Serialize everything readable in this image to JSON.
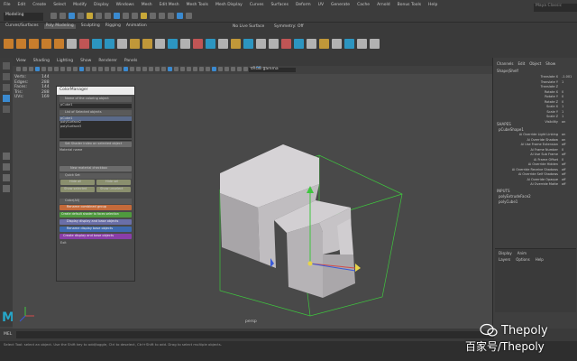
{
  "menubar": {
    "items": [
      "File",
      "Edit",
      "Create",
      "Select",
      "Modify",
      "Display",
      "Windows",
      "Mesh",
      "Edit Mesh",
      "Mesh Tools",
      "Mesh Display",
      "Curves",
      "Surfaces",
      "Deform",
      "UV",
      "Generate",
      "Cache",
      "Arnold",
      "Bonus Tools",
      "Help"
    ],
    "workspace": "Modeling",
    "search_placeholder": "Maya Classic"
  },
  "shelf": {
    "active_tab": "Poly Modeling",
    "tabs": [
      "Curves/Surfaces",
      "Poly Modeling",
      "Sculpting",
      "Rigging",
      "Animation"
    ],
    "no_live_surface": "No Live Surface",
    "symmetry": "Symmetry: Off"
  },
  "viewport_menu": [
    "View",
    "Shading",
    "Lighting",
    "Show",
    "Renderer",
    "Panels"
  ],
  "viewport": {
    "camera_label": "persp",
    "gamma": "sRGB gamma",
    "hud_labels": [
      "Verts:",
      "Edges:",
      "Faces:",
      "Tris:",
      "UVs:"
    ],
    "hud_values": [
      "144",
      "288",
      "144",
      "288",
      "169"
    ],
    "manipulator_colors": {
      "x": "#d24a4a",
      "y": "#3ec63e",
      "z": "#3a5ad8"
    }
  },
  "dialog": {
    "title": "ColorManager",
    "header1": "Name of the coloring object",
    "field_value": "pCube1",
    "header2": "List of Selected objects",
    "list_items": [
      "pCube1",
      "polySurface2",
      "polySurface3"
    ],
    "shader_button": "Set Shader index on selected object",
    "material_label": "Material name",
    "new_material": "New material checkbox",
    "section_label": "Quick Set",
    "buttons": [
      "Hide all",
      "Hide sel",
      "Show selected",
      "Show unselect"
    ],
    "lower_section": "Color(All)",
    "color_buttons": [
      "Rename combined group",
      "Create default shader to faces selection",
      "Display display and base objects",
      "Rename display base objects",
      "Create display and base objects"
    ],
    "footer": "Exit"
  },
  "channel_box": {
    "tabs": [
      "Channels",
      "Edit",
      "Object",
      "Show"
    ],
    "object_name": "Shape|Shelf",
    "attributes": [
      "Translate X",
      "Translate Y",
      "Translate Z",
      "Rotate X",
      "Rotate Y",
      "Rotate Z",
      "Scale X",
      "Scale Y",
      "Scale Z",
      "Visibility"
    ],
    "values": [
      "-1.001",
      "1",
      "",
      "0",
      "0",
      "0",
      "1",
      "1",
      "1",
      "on"
    ],
    "shapes_label": "SHAPES",
    "shape_name": "pCubeShape1",
    "shape_attrs": [
      "Ai Override Light Linking",
      "Ai Override Shadow",
      "Ai Use Frame Extension",
      "Ai Frame Number",
      "Ai Use Sub Frame",
      "Ai Frame Offset",
      "Ai Override Hidden",
      "Ai Override Receive Shadows",
      "Ai Override Self Shadows",
      "Ai Override Opaque",
      "Ai Override Matte"
    ],
    "shape_values": [
      "on",
      "on",
      "off",
      "0",
      "off",
      "0",
      "off",
      "off",
      "off",
      "off",
      "off"
    ],
    "inputs_label": "INPUTS",
    "inputs": [
      "polyExtrudeFace2",
      "polyCube1"
    ],
    "display_tabs": [
      "Display",
      "Anim"
    ],
    "layer_menu": [
      "Layers",
      "Options",
      "Help"
    ]
  },
  "statusbar": {
    "mel": "MEL",
    "help_text": "Select Tool: select an object. Use the Shift key to add/toggle, Ctrl to deselect, Ctrl+Shift to add. Drag to select multiple objects."
  },
  "watermark": {
    "brand": "Thepoly",
    "sub": "百家号/Thepoly"
  }
}
